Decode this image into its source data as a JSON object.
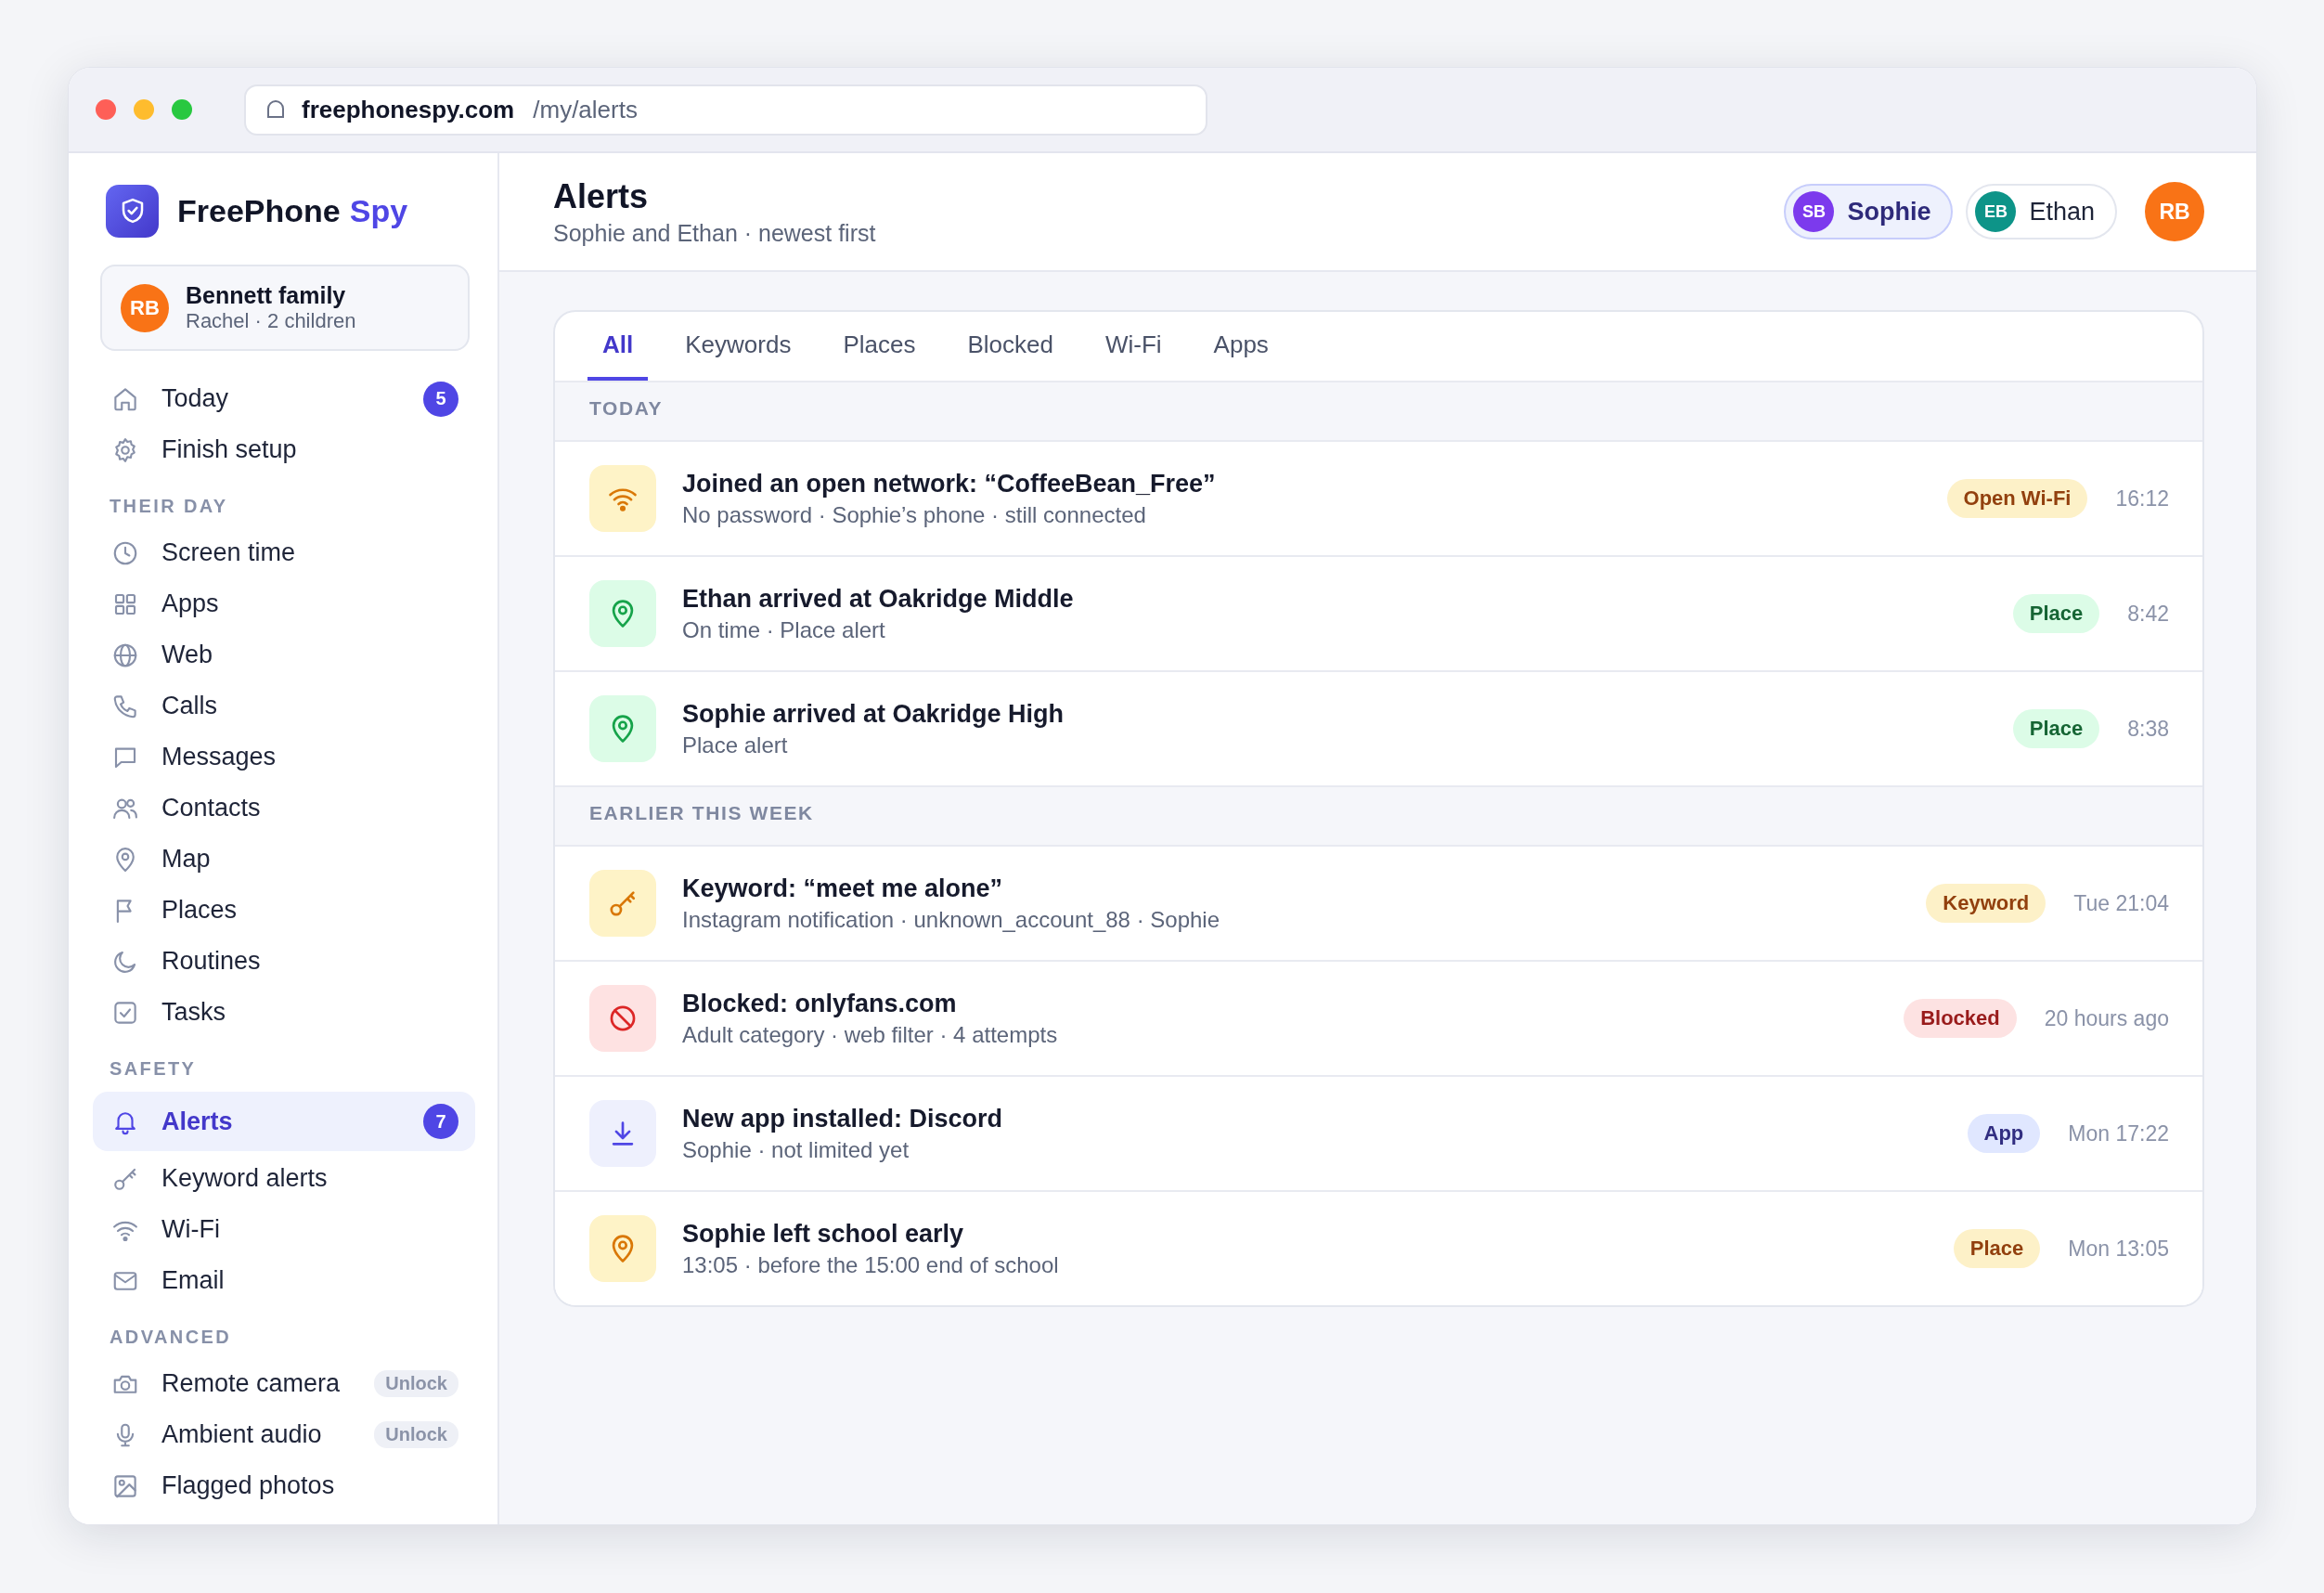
{
  "browser": {
    "domain": "freephonespy.com",
    "path": "/my/alerts"
  },
  "brand": {
    "name": "FreePhone",
    "accent": "Spy"
  },
  "family": {
    "initials": "RB",
    "name": "Bennett family",
    "detail": "Rachel · 2 children"
  },
  "sidebar": {
    "sections": [
      {
        "items": [
          {
            "label": "Today",
            "badge": "5",
            "selected": false
          },
          {
            "label": "Finish setup",
            "selected": false
          }
        ]
      },
      {
        "heading": "THEIR DAY",
        "items": [
          {
            "label": "Screen time",
            "selected": false
          },
          {
            "label": "Apps",
            "selected": false
          },
          {
            "label": "Web",
            "selected": false
          },
          {
            "label": "Calls",
            "selected": false
          },
          {
            "label": "Messages",
            "selected": false
          },
          {
            "label": "Contacts",
            "selected": false
          },
          {
            "label": "Map",
            "selected": false
          },
          {
            "label": "Places",
            "selected": false
          },
          {
            "label": "Routines",
            "selected": false
          },
          {
            "label": "Tasks",
            "selected": false
          }
        ]
      },
      {
        "heading": "SAFETY",
        "items": [
          {
            "label": "Alerts",
            "badge": "7",
            "selected": true
          },
          {
            "label": "Keyword alerts",
            "selected": false
          },
          {
            "label": "Wi-Fi",
            "selected": false
          },
          {
            "label": "Email",
            "selected": false
          }
        ]
      },
      {
        "heading": "ADVANCED",
        "items": [
          {
            "label": "Remote camera",
            "lock": "Unlock",
            "selected": false
          },
          {
            "label": "Ambient audio",
            "lock": "Unlock",
            "selected": false
          },
          {
            "label": "Flagged photos",
            "selected": false
          }
        ]
      }
    ]
  },
  "header": {
    "title": "Alerts",
    "subtitle": "Sophie and Ethan · newest first",
    "children": [
      {
        "initials": "SB",
        "name": "Sophie",
        "color": "#7c3aed",
        "selected": true
      },
      {
        "initials": "EB",
        "name": "Ethan",
        "color": "#0d9488",
        "selected": false
      }
    ],
    "account": {
      "initials": "RB"
    }
  },
  "tabs": [
    {
      "label": "All",
      "selected": true
    },
    {
      "label": "Keywords",
      "selected": false
    },
    {
      "label": "Places",
      "selected": false
    },
    {
      "label": "Blocked",
      "selected": false
    },
    {
      "label": "Wi-Fi",
      "selected": false
    },
    {
      "label": "Apps",
      "selected": false
    }
  ],
  "groups": [
    {
      "heading": "TODAY",
      "alerts": [
        {
          "kind": "wifi",
          "color": "#d97706",
          "title": "Joined an open network: “CoffeeBean_Free”",
          "detail": "No password · Sophie’s phone · still connected",
          "tag": "Open Wi-Fi",
          "time": "16:12"
        },
        {
          "kind": "place",
          "color": "#16a34a",
          "title": "Ethan arrived at Oakridge Middle",
          "detail": "On time · Place alert",
          "tag": "Place",
          "time": "8:42"
        },
        {
          "kind": "place",
          "color": "#16a34a",
          "title": "Sophie arrived at Oakridge High",
          "detail": "Place alert",
          "tag": "Place",
          "time": "8:38"
        }
      ]
    },
    {
      "heading": "EARLIER THIS WEEK",
      "alerts": [
        {
          "kind": "keyword",
          "color": "#d97706",
          "title": "Keyword: “meet me alone”",
          "detail": "Instagram notification · unknown_account_88 · Sophie",
          "tag": "Keyword",
          "time": "Tue 21:04"
        },
        {
          "kind": "blocked",
          "color": "#dc2626",
          "title": "Blocked: onlyfans.com",
          "detail": "Adult category · web filter · 4 attempts",
          "tag": "Blocked",
          "time": "20 hours ago"
        },
        {
          "kind": "app",
          "color": "#4f46e5",
          "title": "New app installed: Discord",
          "detail": "Sophie · not limited yet",
          "tag": "App",
          "time": "Mon 17:22"
        },
        {
          "kind": "place",
          "color": "#d97706",
          "title": "Sophie left school early",
          "detail": "13:05 · before the 15:00 end of school",
          "tag": "Place",
          "time": "Mon 13:05"
        }
      ]
    }
  ]
}
